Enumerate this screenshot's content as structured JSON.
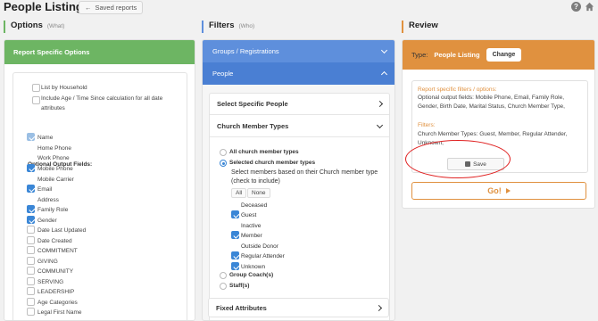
{
  "page": {
    "title": "People Listing",
    "saved_reports_label": "Saved reports"
  },
  "columns": {
    "options": {
      "heading": "Options",
      "sub": "(What)"
    },
    "filters": {
      "heading": "Filters",
      "sub": "(Who)"
    },
    "review": {
      "heading": "Review"
    }
  },
  "colors": {
    "options_accent": "#6db563",
    "filters_accent": "#5e8fdc",
    "review_accent": "#e0913f",
    "checkbox": "#3a86d6"
  },
  "options": {
    "header": "Report Specific Options",
    "top_items": [
      {
        "label": "List by Household",
        "checked": false
      },
      {
        "label": "Include Age / Time Since calculation for all date",
        "label2": "attributes",
        "checked": false
      }
    ],
    "output_fields_label": "Optional Output Fields:",
    "fields": [
      {
        "label": "Name",
        "checked": true,
        "partial": true
      },
      {
        "label": "Home Phone",
        "checked": false
      },
      {
        "label": "Work Phone",
        "checked": false
      },
      {
        "label": "Mobile Phone",
        "checked": true
      },
      {
        "label": "Mobile Carrier",
        "checked": false
      },
      {
        "label": "Email",
        "checked": true
      },
      {
        "label": "Address",
        "checked": false
      },
      {
        "label": "Family Role",
        "checked": true
      },
      {
        "label": "Gender",
        "checked": true
      },
      {
        "label": "Date Last Updated",
        "checked": false
      },
      {
        "label": "Date Created",
        "checked": false
      },
      {
        "label": "COMMITMENT",
        "checked": false
      },
      {
        "label": "GIVING",
        "checked": false
      },
      {
        "label": "COMMUNITY",
        "checked": false
      },
      {
        "label": "SERVING",
        "checked": false
      },
      {
        "label": "LEADERSHIP",
        "checked": false
      },
      {
        "label": "Age Categories",
        "checked": false
      },
      {
        "label": "Legal First Name",
        "checked": false
      }
    ]
  },
  "filters": {
    "groups_label": "Groups / Registrations",
    "people_label": "People",
    "select_specific_people": "Select Specific People",
    "church_member_types": "Church Member Types",
    "all_types": "All church member types",
    "selected_types": "Selected church member types",
    "instruction": "Select members based on their Church member type (check to include)",
    "all_btn": "All",
    "none_btn": "None",
    "member_types": [
      {
        "label": "Deceased",
        "checked": false
      },
      {
        "label": "Guest",
        "checked": true
      },
      {
        "label": "Inactive",
        "checked": false
      },
      {
        "label": "Member",
        "checked": true
      },
      {
        "label": "Outside Donor",
        "checked": false
      },
      {
        "label": "Regular Attender",
        "checked": true
      },
      {
        "label": "Unknown",
        "checked": true
      }
    ],
    "group_coach": "Group Coach(s)",
    "staff": "Staff(s)",
    "fixed_attributes": "Fixed Attributes"
  },
  "review": {
    "type_label": "Type:",
    "type_value": "People Listing",
    "change_label": "Change",
    "options_title": "Report specific filters / options:",
    "options_text": "Optional output fields: Mobile Phone, Email, Family Role, Gender, Birth Date, Marital Status, Church Member Type,",
    "filters_title": "Filters:",
    "filters_text": "Church Member Types: Guest, Member, Regular Attender, Unknown,",
    "save_label": "Save",
    "go_label": "Go!"
  }
}
